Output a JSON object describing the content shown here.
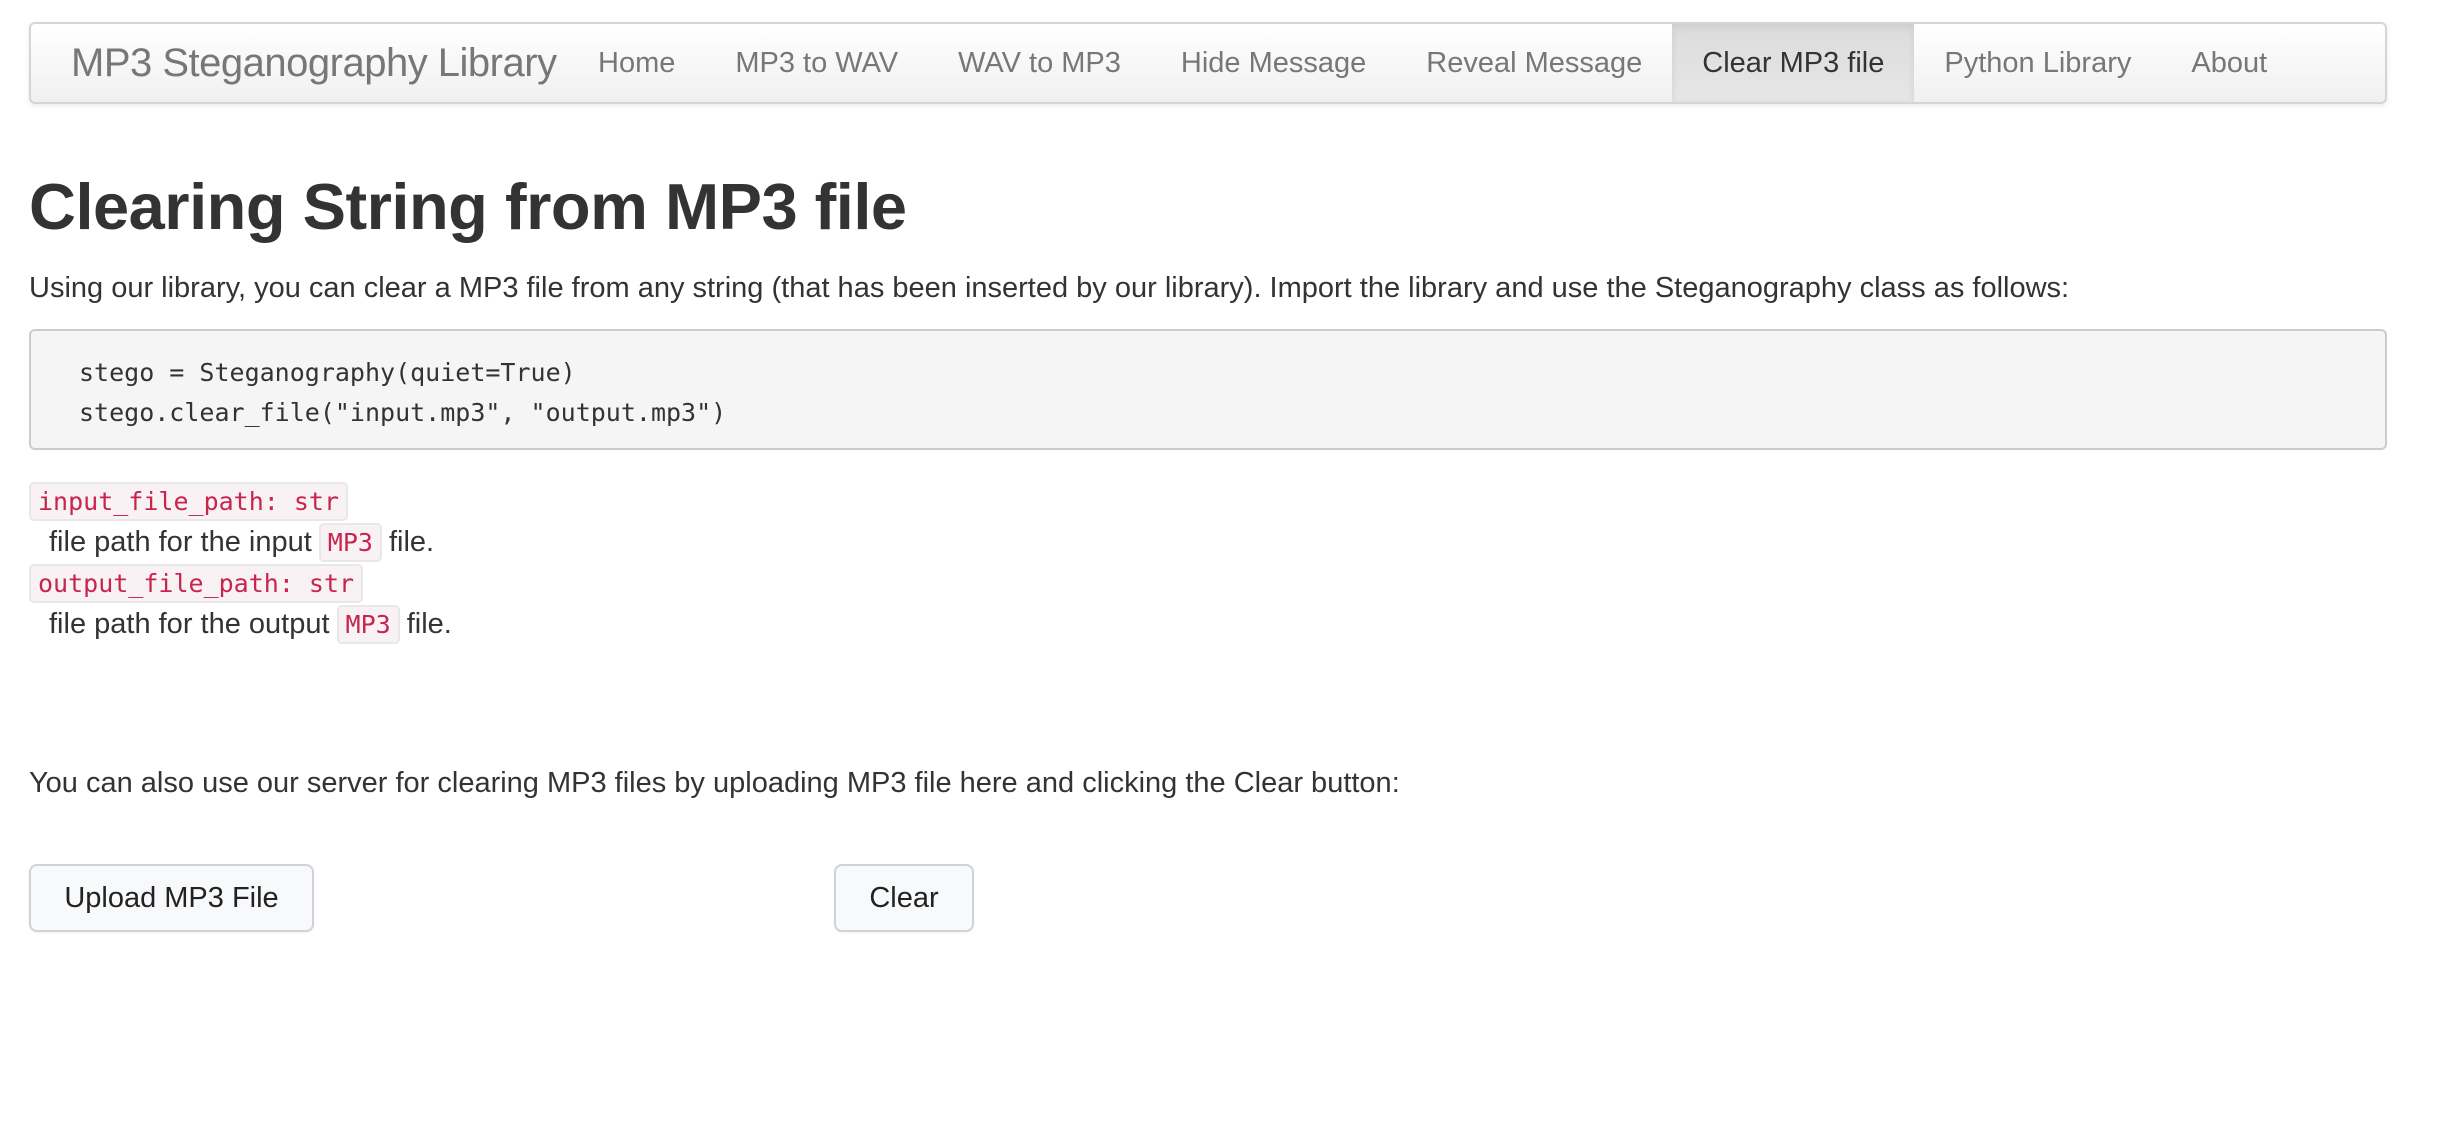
{
  "navbar": {
    "brand": "MP3 Steganography Library",
    "items": [
      {
        "label": "Home",
        "active": false
      },
      {
        "label": "MP3 to WAV",
        "active": false
      },
      {
        "label": "WAV to MP3",
        "active": false
      },
      {
        "label": "Hide Message",
        "active": false
      },
      {
        "label": "Reveal Message",
        "active": false
      },
      {
        "label": "Clear MP3 file",
        "active": true
      },
      {
        "label": "Python Library",
        "active": false
      },
      {
        "label": "About",
        "active": false
      }
    ]
  },
  "main": {
    "title": "Clearing String from MP3 file",
    "intro": "Using our library, you can clear a MP3 file from any string (that has been inserted by our library). Import the library and use the Steganography class as follows:",
    "code_lines": [
      "stego = Steganography(quiet=True)",
      "stego.clear_file(\"input.mp3\", \"output.mp3\")"
    ],
    "params": [
      {
        "name": "input_file_path: str",
        "desc_before": "file path for the input",
        "desc_code": "MP3",
        "desc_after": "file."
      },
      {
        "name": "output_file_path: str",
        "desc_before": "file path for the output",
        "desc_code": "MP3",
        "desc_after": "file."
      }
    ],
    "server_text": "You can also use our server for clearing MP3 files by uploading MP3 file here and clicking the Clear button:",
    "upload_button": "Upload MP3 File",
    "clear_button": "Clear"
  },
  "colors": {
    "inline_code_text": "#c7254e",
    "inline_code_bg": "#f9f2f4",
    "nav_text": "#777777",
    "active_nav_bg": "#e0e0e0"
  }
}
